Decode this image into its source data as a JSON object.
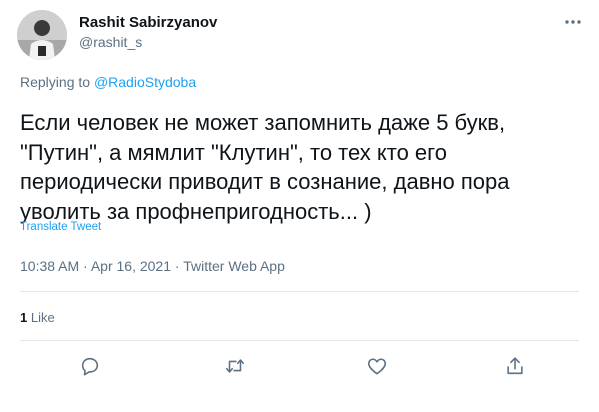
{
  "author": {
    "display_name": "Rashit Sabirzyanov",
    "handle": "@rashit_s",
    "avatar_icon": "user-photo-icon"
  },
  "reply": {
    "prefix": "Replying to",
    "handle": "@RadioStydoba"
  },
  "tweet": {
    "text": "Если человек не может запомнить даже 5 букв,\n\"Путин\", а мямлит \"Клутин\", то тех кто его\nпериодически приводит в сознание, давно пора\nуволить за профнепригодность... )",
    "translate_label": "Translate Tweet"
  },
  "meta": {
    "time": "10:38 AM",
    "date": "Apr 16, 2021",
    "source": "Twitter Web App",
    "separator": " · "
  },
  "stats": {
    "likes_count": "1",
    "likes_label": "Like"
  },
  "actions": [
    "reply-icon",
    "retweet-icon",
    "like-icon",
    "share-icon"
  ],
  "colors": {
    "text": "#0f1419",
    "secondary": "#5b7083",
    "accent": "#1da1f2",
    "divider": "#e1e8ed"
  }
}
